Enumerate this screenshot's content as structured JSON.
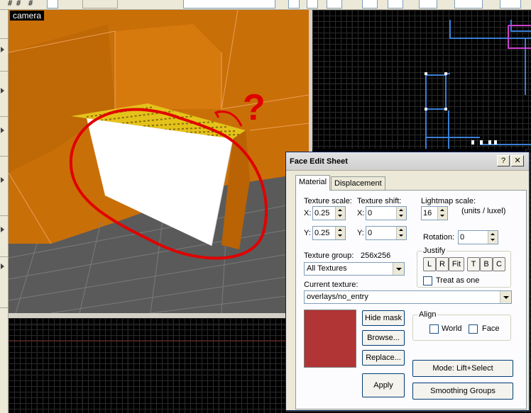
{
  "camera": {
    "label": "camera"
  },
  "dialog": {
    "title": "Face Edit Sheet",
    "help_glyph": "?",
    "close_glyph": "✕",
    "tabs": [
      "Material",
      "Displacement"
    ],
    "texture_scale": {
      "label": "Texture scale:",
      "x_label": "X:",
      "x": "0.25",
      "y_label": "Y:",
      "y": "0.25"
    },
    "texture_shift": {
      "label": "Texture shift:",
      "x_label": "X:",
      "x": "0",
      "y_label": "Y:",
      "y": "0"
    },
    "lightmap_scale": {
      "label": "Lightmap scale:",
      "value": "16",
      "units": "(units / luxel)"
    },
    "rotation": {
      "label": "Rotation:",
      "value": "0"
    },
    "justify": {
      "label": "Justify",
      "buttons": [
        "L",
        "R",
        "Fit",
        "T",
        "B",
        "C"
      ],
      "treat_as_one": "Treat as one"
    },
    "texture_group": {
      "label": "Texture group:",
      "size": "256x256",
      "value": "All Textures"
    },
    "current_texture": {
      "label": "Current texture:",
      "value": "overlays/no_entry"
    },
    "buttons": {
      "hide_mask": "Hide mask",
      "browse": "Browse...",
      "replace": "Replace...",
      "apply": "Apply",
      "mode": "Mode: Lift+Select",
      "smoothing": "Smoothing Groups"
    },
    "align": {
      "label": "Align",
      "world": "World",
      "face": "Face"
    },
    "texture_color": "#b23535"
  },
  "annotation": {
    "mark": "?",
    "color": "#e00000"
  },
  "colors": {
    "camera_bg": "#c96f08",
    "floor": "#5a5a5a",
    "brush_top": "#e4c21a",
    "brush_face": "#ffffff"
  },
  "toolbar": {
    "glyphs": [
      "#",
      "#",
      "#"
    ]
  }
}
